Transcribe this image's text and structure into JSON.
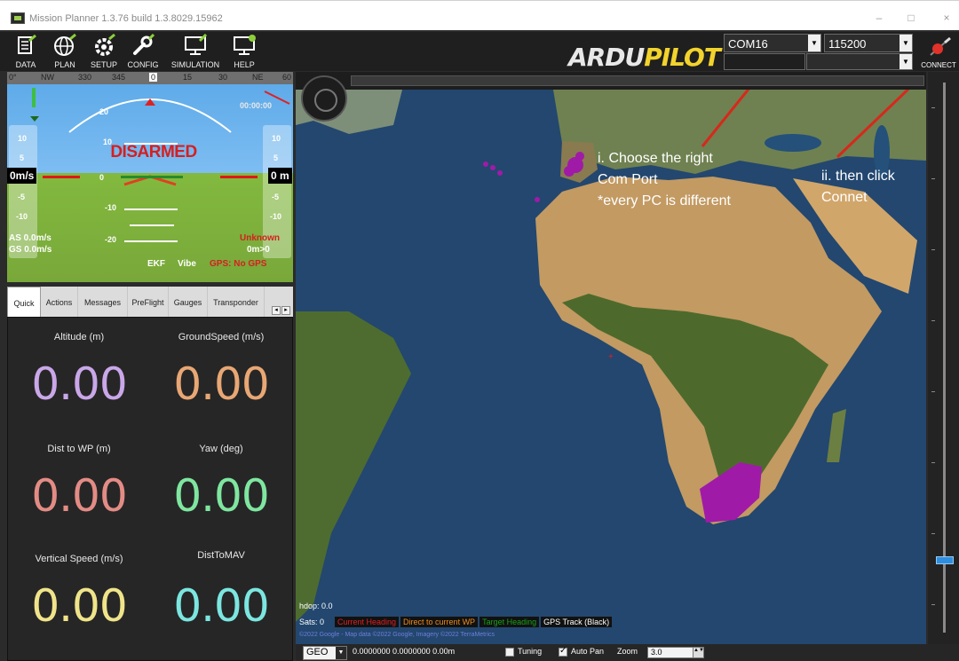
{
  "window": {
    "title": "Mission Planner 1.3.76 build 1.3.8029.15962",
    "minimize_glyph": "–",
    "maximize_glyph": "□",
    "close_glyph": "×"
  },
  "toolbar": {
    "buttons": [
      {
        "label": "DATA",
        "icon": "data-icon"
      },
      {
        "label": "PLAN",
        "icon": "globe-icon"
      },
      {
        "label": "SETUP",
        "icon": "gear-icon"
      },
      {
        "label": "CONFIG",
        "icon": "wrench-icon"
      },
      {
        "label": "SIMULATION",
        "icon": "monitor-icon"
      },
      {
        "label": "HELP",
        "icon": "help-monitor-icon"
      }
    ],
    "logo_part1": "ARDU",
    "logo_part2": "PILOT",
    "com_port": "COM16",
    "baud_rate": "115200",
    "connect_label": "CONNECT"
  },
  "hud": {
    "heading_marks": [
      "0°",
      "NW",
      "330",
      "345",
      "0",
      "15",
      "30",
      "NE",
      "60"
    ],
    "status": "DISARMED",
    "left_tape": [
      "10",
      "5",
      "-5",
      "-10"
    ],
    "right_tape": [
      "10",
      "5",
      "-5",
      "-10"
    ],
    "left_speed": "0m/s",
    "right_alt": "0 m",
    "pitch_marks": [
      "20",
      "10",
      "0",
      "-10",
      "-20"
    ],
    "roll_marks": [
      "-30",
      "-20",
      "-10",
      "0",
      "10",
      "20",
      "30"
    ],
    "airspeed": "AS 0.0m/s",
    "groundspeed": "GS 0.0m/s",
    "timer": "00:00:00",
    "unknown": "Unknown",
    "dist": "0m>0",
    "ekf": "EKF",
    "vibe": "Vibe",
    "gps": "GPS: No GPS"
  },
  "tabs": [
    {
      "label": "Quick",
      "active": true
    },
    {
      "label": "Actions",
      "active": false
    },
    {
      "label": "Messages",
      "active": false
    },
    {
      "label": "PreFlight",
      "active": false
    },
    {
      "label": "Gauges",
      "active": false
    },
    {
      "label": "Transponder",
      "active": false
    }
  ],
  "quick": [
    {
      "label": "Altitude (m)",
      "value": "0.00",
      "color": "#c9a7e8"
    },
    {
      "label": "GroundSpeed (m/s)",
      "value": "0.00",
      "color": "#e8a774"
    },
    {
      "label": "Dist to WP (m)",
      "value": "0.00",
      "color": "#e38c85"
    },
    {
      "label": "Yaw (deg)",
      "value": "0.00",
      "color": "#7fe6a0"
    },
    {
      "label": "Vertical Speed (m/s)",
      "value": "0.00",
      "color": "#f0e48a"
    },
    {
      "label": "DistToMAV",
      "value": "0.00",
      "color": "#7ce6e0"
    }
  ],
  "map": {
    "note1_line1": "i. Choose the right",
    "note1_line2": "Com Port",
    "note1_line3": "*every PC is different",
    "note2_line1": "ii. then click",
    "note2_line2": "Connet",
    "hdop": "hdop: 0.0",
    "sats": "Sats: 0",
    "legend": [
      {
        "label": "Current Heading",
        "color": "#e02020"
      },
      {
        "label": "Direct to current WP",
        "color": "#f08c1a"
      },
      {
        "label": "Target Heading",
        "color": "#19a019"
      },
      {
        "label": "GPS Track (Black)",
        "color": "#ffffff"
      }
    ],
    "copyright": "©2022 Google - Map data ©2022 Google, Imagery ©2022 TerraMetrics",
    "accent_track": "#a01aa8",
    "annotation_arrow": "#d7281c"
  },
  "statusbar": {
    "coord_mode": "GEO",
    "coords": "0.0000000 0.0000000 0.00m",
    "tuning_label": "Tuning",
    "autopan_label": "Auto Pan",
    "zoom_label": "Zoom",
    "zoom_value": "3.0"
  }
}
